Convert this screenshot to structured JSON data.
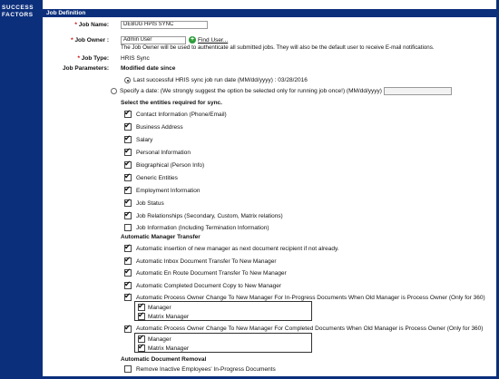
{
  "sidebar": {
    "logo_line1": "SUCCESS",
    "logo_line2": "FACTORS"
  },
  "header": {
    "title": "Job Definition"
  },
  "fields": {
    "job_name": {
      "label": "Job Name:",
      "value": "DEBUG HPIS SYNC"
    },
    "job_owner": {
      "label": "Job Owner :",
      "value": "Admin User",
      "find_label": "Find User...",
      "note": "The Job Owner will be used to authenticate all submitted jobs. They will also be the default user to receive E-mail notifications."
    },
    "job_type": {
      "label": "Job Type:",
      "value": "HRIS Sync"
    },
    "job_params_label": "Job Parameters:"
  },
  "params": {
    "modified_heading": "Modified date since",
    "radio_last": "Last successful HRIS sync job run date  (MM/dd/yyyy)   : 03/28/2016",
    "radio_specify": "Specify a date: (We strongly suggest the option be selected only for running job once!)  (MM/dd/yyyy)",
    "entities_heading": "Select the entities required for sync.",
    "entities": [
      {
        "label": "Contact Information (Phone/Email)",
        "checked": true
      },
      {
        "label": "Business Address",
        "checked": true
      },
      {
        "label": "Salary",
        "checked": true
      },
      {
        "label": "Personal Information",
        "checked": true
      },
      {
        "label": "Biographical (Person Info)",
        "checked": true
      },
      {
        "label": "Generic Entities",
        "checked": true
      },
      {
        "label": "Employment Information",
        "checked": true
      },
      {
        "label": "Job Status",
        "checked": true
      },
      {
        "label": "Job Relationships (Secondary, Custom, Matrix relations)",
        "checked": true
      },
      {
        "label": "Job Information (Including Termination Information)",
        "checked": false
      }
    ],
    "amt_heading": "Automatic Manager Transfer",
    "amt": [
      {
        "label": "Automatic insertion of new manager as next document recipient if not already.",
        "checked": true
      },
      {
        "label": "Automatic Inbox Document Transfer To New Manager",
        "checked": true
      },
      {
        "label": "Automatic En Route Document Transfer To New Manager",
        "checked": true
      },
      {
        "label": "Automatic Completed Document Copy to New Manager",
        "checked": true
      },
      {
        "label": "Automatic Process Owner Change To New Manager For In-Progress Documents When Old Manager is Process Owner (Only for 360)",
        "checked": true
      },
      {
        "label": "Automatic Process Owner Change To New Manager For Completed Documents When Old Manager is Process Owner (Only for 360)",
        "checked": true
      }
    ],
    "sub_inprogress": [
      {
        "label": "Manager",
        "checked": true
      },
      {
        "label": "Matrix Manager",
        "checked": true
      }
    ],
    "sub_completed": [
      {
        "label": "Manager",
        "checked": true
      },
      {
        "label": "Matrix Manager",
        "checked": true
      }
    ],
    "removal_heading": "Automatic Document Removal",
    "removal": [
      {
        "label": "Remove Inactive Employees' In-Progress Documents",
        "checked": false
      }
    ]
  }
}
